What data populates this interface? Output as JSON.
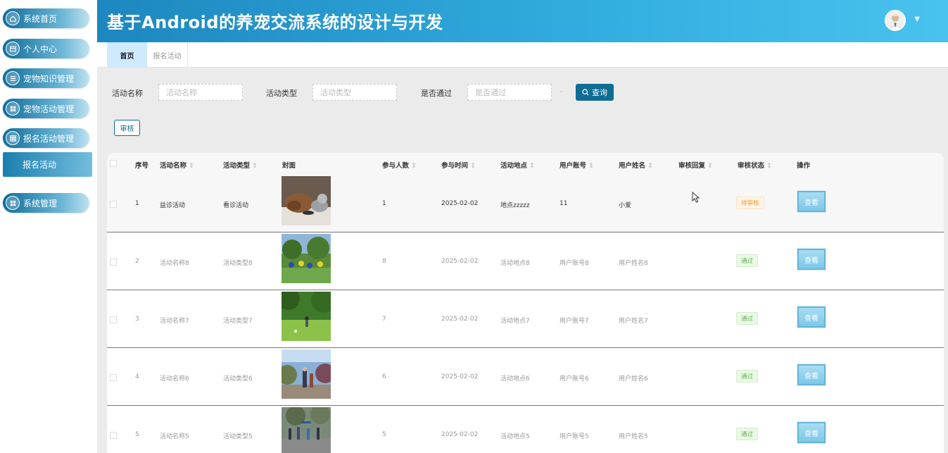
{
  "app": {
    "title": "基于Android的养宠交流系统的设计与开发"
  },
  "sidebar": {
    "items": [
      {
        "label": "系统首页",
        "icon": "home-icon"
      },
      {
        "label": "个人中心",
        "icon": "card-icon"
      },
      {
        "label": "宠物知识管理",
        "icon": "list-icon"
      },
      {
        "label": "宠物活动管理",
        "icon": "grid-icon"
      },
      {
        "label": "报名活动管理",
        "icon": "table-icon"
      },
      {
        "label": "系统管理",
        "icon": "grid-icon"
      }
    ],
    "subitem": {
      "label": "报名活动"
    }
  },
  "tabs": [
    {
      "label": "首页",
      "active": true
    },
    {
      "label": "报名活动",
      "active": false
    }
  ],
  "filters": {
    "name_label": "活动名称",
    "name_placeholder": "活动名称",
    "type_label": "活动类型",
    "type_placeholder": "活动类型",
    "pass_label": "是否通过",
    "pass_placeholder": "是否通过",
    "search_button": "查询"
  },
  "actions": {
    "review_button": "审核"
  },
  "table": {
    "headers": [
      "序号",
      "活动名称",
      "活动类型",
      "封面",
      "参与人数",
      "参与时间",
      "活动地点",
      "用户账号",
      "用户姓名",
      "审核回复",
      "审核状态",
      "操作"
    ],
    "sortable": [
      false,
      true,
      true,
      false,
      true,
      true,
      true,
      true,
      true,
      true,
      true,
      false
    ],
    "view_label": "查看",
    "rows": [
      {
        "index": "1",
        "name": "益诊活动",
        "type": "看诊活动",
        "count": "1",
        "date": "2025-02-02",
        "place": "地点zzzzz",
        "account": "11",
        "username": "小爱",
        "reply": "",
        "status": "待审核",
        "status_kind": "wait",
        "dark": true
      },
      {
        "index": "2",
        "name": "活动名称8",
        "type": "活动类型8",
        "count": "8",
        "date": "2025-02-02",
        "place": "活动地点8",
        "account": "用户账号8",
        "username": "用户姓名8",
        "reply": "",
        "status": "通过",
        "status_kind": "pass",
        "dark": false
      },
      {
        "index": "3",
        "name": "活动名称7",
        "type": "活动类型7",
        "count": "7",
        "date": "2025-02-02",
        "place": "活动地点7",
        "account": "用户账号7",
        "username": "用户姓名7",
        "reply": "",
        "status": "通过",
        "status_kind": "pass",
        "dark": false
      },
      {
        "index": "4",
        "name": "活动名称6",
        "type": "活动类型6",
        "count": "6",
        "date": "2025-02-02",
        "place": "活动地点6",
        "account": "用户账号6",
        "username": "用户姓名6",
        "reply": "",
        "status": "通过",
        "status_kind": "pass",
        "dark": false
      },
      {
        "index": "5",
        "name": "活动名称5",
        "type": "活动类型5",
        "count": "5",
        "date": "2025-02-02",
        "place": "活动地点5",
        "account": "用户账号5",
        "username": "用户姓名5",
        "reply": "",
        "status": "通过",
        "status_kind": "pass",
        "dark": false
      }
    ]
  },
  "colors": {
    "header_start": "#1d87c0",
    "header_end": "#49c2ee",
    "accent": "#0f6c95",
    "pass": "#5fb64a",
    "wait": "#ee9b32"
  }
}
